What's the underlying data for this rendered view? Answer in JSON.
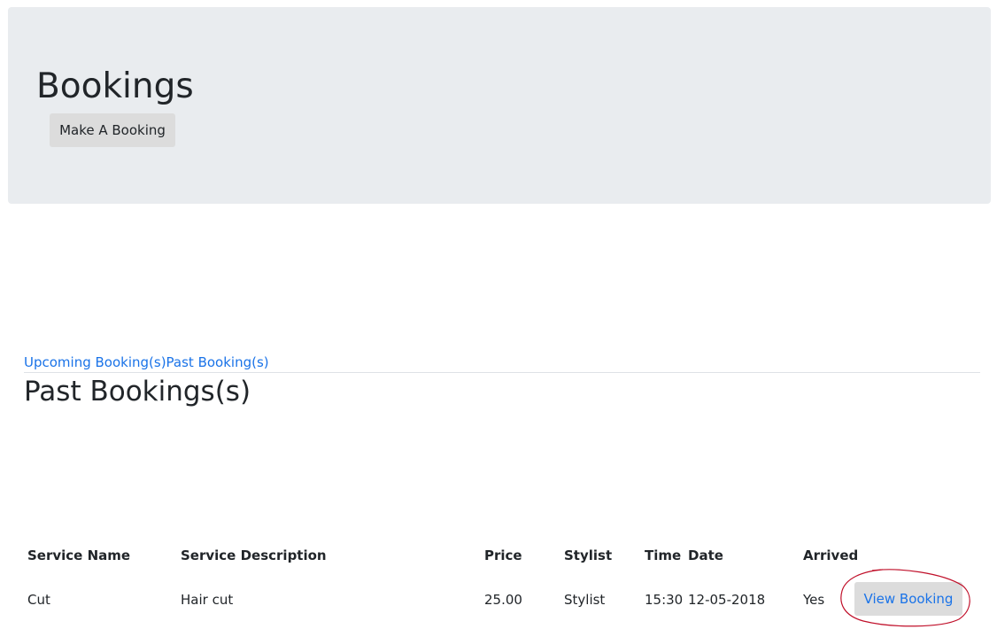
{
  "header": {
    "title": "Bookings",
    "make_booking_label": "Make A Booking"
  },
  "tabs": {
    "upcoming_label": "Upcoming Booking(s)",
    "past_label": "Past Booking(s)"
  },
  "section": {
    "title": "Past Bookings(s)"
  },
  "table": {
    "headers": [
      "Service Name",
      "Service Description",
      "Price",
      "Stylist",
      "Time",
      "Date",
      "Arrived"
    ],
    "rows": [
      {
        "service_name": "Cut",
        "service_description": "Hair cut",
        "price": "25.00",
        "stylist": "Stylist",
        "time": "15:30",
        "date": "12-05-2018",
        "arrived": "Yes",
        "action_label": "View Booking"
      }
    ]
  },
  "colors": {
    "jumbotron_bg": "#e9ecef",
    "link": "#1a73e8",
    "button_bg": "#dcdcdc",
    "annotation": "#c0102a"
  }
}
